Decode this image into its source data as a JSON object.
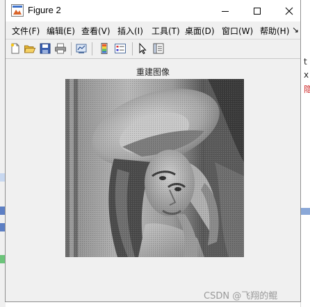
{
  "window": {
    "title": "Figure 2",
    "controls": {
      "minimize": "minimize-icon",
      "maximize": "maximize-icon",
      "close": "close-icon"
    }
  },
  "menu": {
    "items": [
      "文件(F)",
      "编辑(E)",
      "查看(V)",
      "插入(I)",
      "工具(T)",
      "桌面(D)",
      "窗口(W)",
      "帮助(H)"
    ],
    "overflow_glyph": "↘"
  },
  "toolbar": {
    "buttons": [
      "new-figure-icon",
      "open-file-icon",
      "save-icon",
      "print-icon",
      "link-plot-icon",
      "colorbar-icon",
      "legend-icon",
      "edit-plot-arrow-icon",
      "property-inspector-icon"
    ]
  },
  "figure": {
    "axes_title": "重建图像",
    "image_description": "grayscale reconstructed image of a woman wearing a wide-brimmed hat"
  },
  "background": {
    "right_text": [
      "t",
      "x",
      "隐"
    ],
    "accent_colors": [
      "#8aa8d8",
      "#cc2222"
    ]
  },
  "watermark": "CSDN @飞翔的鲲"
}
